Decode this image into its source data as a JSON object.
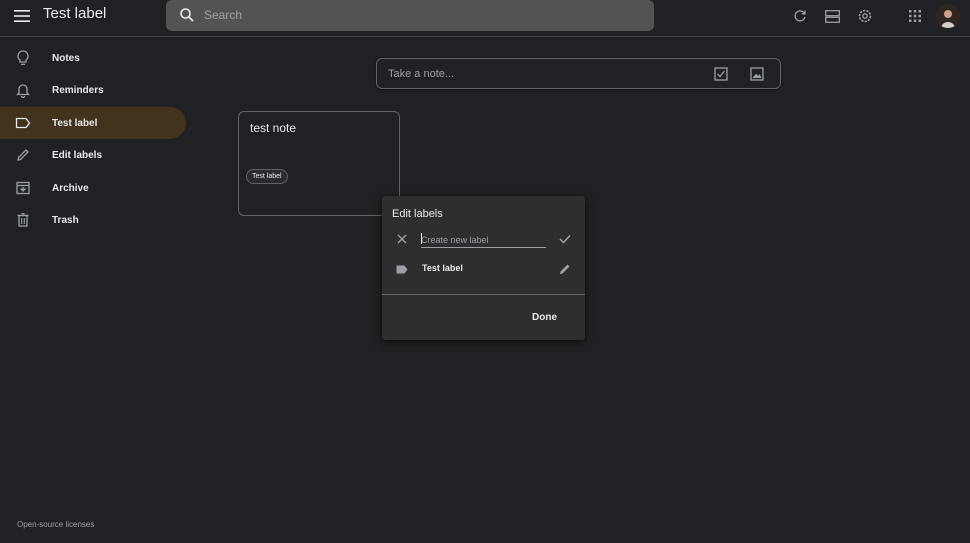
{
  "header": {
    "title": "Test label",
    "search_placeholder": "Search",
    "icons": [
      "menu-icon",
      "search-icon",
      "refresh-icon",
      "list-view-icon",
      "settings-icon",
      "apps-icon"
    ]
  },
  "sidebar": {
    "items": [
      {
        "label": "Notes",
        "icon": "lightbulb-icon",
        "active": false
      },
      {
        "label": "Reminders",
        "icon": "bell-icon",
        "active": false
      },
      {
        "label": "Test label",
        "icon": "label-outline-icon",
        "active": true
      },
      {
        "label": "Edit labels",
        "icon": "pencil-icon",
        "active": false
      },
      {
        "label": "Archive",
        "icon": "archive-icon",
        "active": false
      },
      {
        "label": "Trash",
        "icon": "trash-icon",
        "active": false
      }
    ],
    "footer_link": "Open-source licenses"
  },
  "composer": {
    "placeholder": "Take a note..."
  },
  "notes": [
    {
      "title": "test note",
      "labels": [
        "Test label"
      ]
    }
  ],
  "edit_labels_dialog": {
    "title": "Edit labels",
    "new_label_placeholder": "Create new label",
    "labels": [
      "Test label"
    ],
    "done_label": "Done"
  },
  "colors": {
    "background": "#202124",
    "active_sidebar": "#41331c",
    "search_bg": "#525355",
    "dialog_bg": "#2d2e30"
  }
}
